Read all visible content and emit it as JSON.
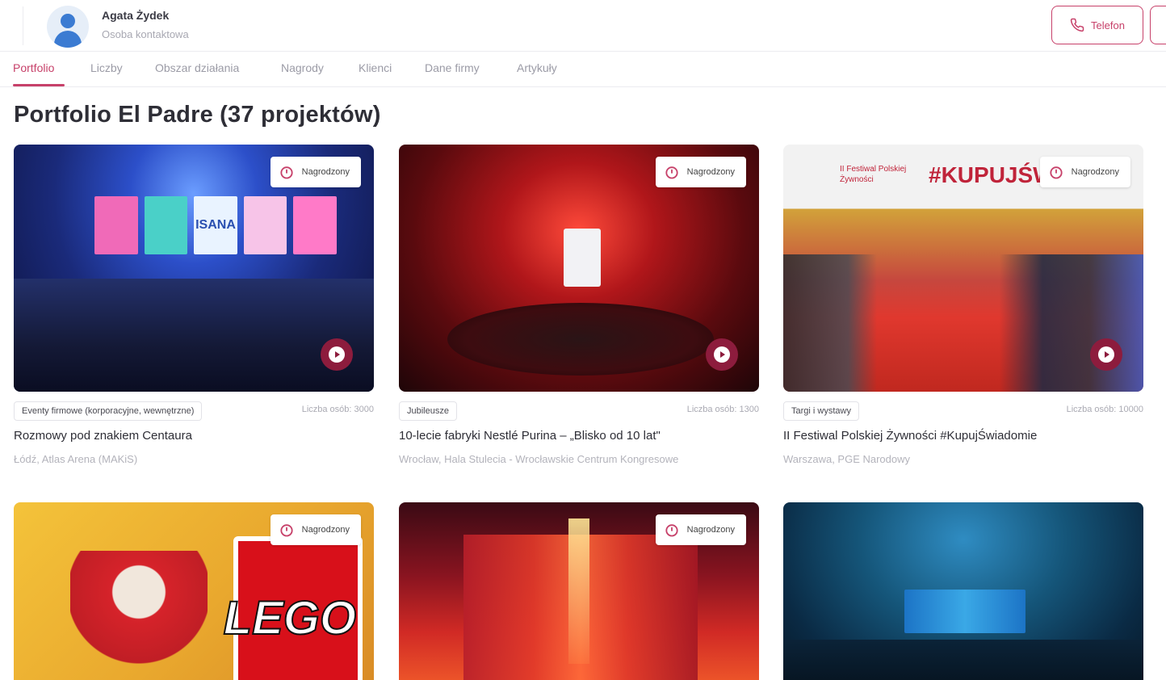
{
  "header": {
    "contact_name": "Agata Żydek",
    "contact_role": "Osoba kontaktowa",
    "phone_button_label": "Telefon"
  },
  "tabs": [
    {
      "label": "Portfolio",
      "active": true
    },
    {
      "label": "Liczby",
      "active": false
    },
    {
      "label": "Obszar działania",
      "active": false
    },
    {
      "label": "Nagrody",
      "active": false
    },
    {
      "label": "Klienci",
      "active": false
    },
    {
      "label": "Dane firmy",
      "active": false
    },
    {
      "label": "Artykuły",
      "active": false
    }
  ],
  "page_title": "Portfolio El Padre (37 projektów)",
  "colors": {
    "accent": "#c7416a",
    "play_button": "#8d1c3d"
  },
  "projects": [
    {
      "badge": "Nagrodzony",
      "category": "Eventy firmowe (korporacyjne, wewnętrzne)",
      "count": "Liczba osób: 3000",
      "title": "Rozmowy pod znakiem Centaura",
      "location": "Łódź, Atlas Arena (MAKiS)",
      "has_video": true,
      "screen_text": "ISANA"
    },
    {
      "badge": "Nagrodzony",
      "category": "Jubileusze",
      "count": "Liczba osób: 1300",
      "title": "10-lecie fabryki Nestlé Purina – „Blisko od 10 lat\"",
      "location": "Wrocław, Hala Stulecia - Wrocławskie Centrum Kongresowe",
      "has_video": true
    },
    {
      "badge": "Nagrodzony",
      "category": "Targi i wystawy",
      "count": "Liczba osób: 10000",
      "title": "II Festiwal Polskiej Żywności #KupujŚwiadomie",
      "location": "Warszawa, PGE Narodowy",
      "has_video": true,
      "banner_text": "#KUPUJŚWI",
      "banner_sub": "II Festiwal Polskiej Żywności"
    },
    {
      "badge": "Nagrodzony",
      "has_video": false,
      "logo_text": "LEGO"
    },
    {
      "badge": "Nagrodzony",
      "has_video": false
    },
    {
      "has_video": false
    }
  ],
  "icons": {
    "phone": "phone-icon",
    "award": "award-icon",
    "play": "play-icon"
  }
}
